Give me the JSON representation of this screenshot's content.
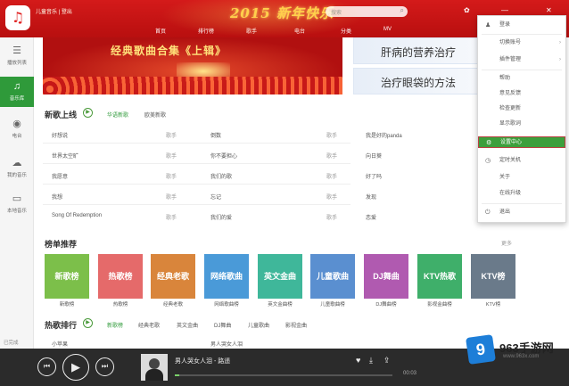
{
  "app": {
    "logo_glyph": "♫",
    "user_text": "儿童音乐 | 登出",
    "festive_banner": "2015 新年快乐"
  },
  "header": {
    "tabs": [
      "首页",
      "排行榜",
      "歌手",
      "电台",
      "分类",
      "MV"
    ],
    "search_placeholder": "搜索",
    "window_controls": {
      "skin": "✿",
      "minimize": "—",
      "close": "✕"
    }
  },
  "sidebar": {
    "items": [
      {
        "icon": "☰",
        "label": "播放列表",
        "active": false
      },
      {
        "icon": "♫",
        "label": "音乐库",
        "active": true
      },
      {
        "icon": "◉",
        "label": "电台",
        "active": false
      },
      {
        "icon": "☁",
        "label": "我的音乐",
        "active": false
      },
      {
        "icon": "▭",
        "label": "本地音乐",
        "active": false
      }
    ],
    "bottom_label": "已完成"
  },
  "banners": {
    "main_title": "经典歌曲合集《上辑》",
    "side": [
      "肝病的营养治疗",
      "治疗眼袋的方法"
    ]
  },
  "new_songs": {
    "title": "新歌上线",
    "tabs": [
      "华语新歌",
      "欧美新歌"
    ],
    "rows": [
      {
        "left_title": "好想说",
        "left_artist": "歌手",
        "right_title": "倒数",
        "right_artist": "歌手"
      },
      {
        "left_title": "世界太空旷",
        "left_artist": "歌手",
        "right_title": "你不要担心",
        "right_artist": "歌手"
      },
      {
        "left_title": "我愿意",
        "left_artist": "歌手",
        "right_title": "我们的歌",
        "right_artist": "歌手"
      },
      {
        "left_title": "我想",
        "left_artist": "歌手",
        "right_title": "忘记",
        "right_artist": "歌手"
      },
      {
        "left_title": "Song Of Redemption",
        "left_artist": "歌手",
        "right_title": "我们的爱",
        "right_artist": "歌手"
      }
    ],
    "rows_right": [
      {
        "title": "我是好的panda",
        "artist": "歌手"
      },
      {
        "title": "向日葵",
        "artist": "歌手"
      },
      {
        "title": "好了吗",
        "artist": "歌手"
      },
      {
        "title": "发现",
        "artist": "歌手"
      },
      {
        "title": "恋爱",
        "artist": "歌手"
      }
    ]
  },
  "rankings": {
    "title": "榜单推荐",
    "more": "更多",
    "tiles": [
      {
        "label": "新歌榜",
        "caption": "新歌榜",
        "color": "#7cbf4a"
      },
      {
        "label": "热歌榜",
        "caption": "热歌榜",
        "color": "#e56a6a"
      },
      {
        "label": "经典老歌",
        "caption": "经典老歌",
        "color": "#d9853b"
      },
      {
        "label": "网络歌曲",
        "caption": "网络歌曲榜",
        "color": "#4a9ad8"
      },
      {
        "label": "英文金曲",
        "caption": "英文金曲榜",
        "color": "#3fb79a"
      },
      {
        "label": "儿童歌曲",
        "caption": "儿童歌曲榜",
        "color": "#5a8fd0"
      },
      {
        "label": "DJ舞曲",
        "caption": "DJ舞曲榜",
        "color": "#b05ab0"
      },
      {
        "label": "KTV热歌",
        "caption": "影视金曲榜",
        "color": "#3faf6a"
      },
      {
        "label": "KTV榜",
        "caption": "KTV榜",
        "color": "#6a7a8a"
      }
    ]
  },
  "hot": {
    "title": "热歌排行",
    "tabs": [
      "新歌榜",
      "经典老歌",
      "英文金曲",
      "DJ舞曲",
      "儿童歌曲",
      "影视金曲"
    ],
    "first_row_left": "小苹果",
    "first_row_right": "男人哭女人泪"
  },
  "player": {
    "now_playing": "男人哭女人泪 - 路遥",
    "progress": 0.02,
    "time": "00:03"
  },
  "menu": {
    "items": [
      {
        "icon": "♟",
        "label": "登录"
      },
      {
        "icon": "",
        "label": "切换账号",
        "arrow": "›"
      },
      {
        "icon": "",
        "label": "插件管理",
        "arrow": "›"
      },
      {
        "icon": "",
        "label": "帮助"
      },
      {
        "icon": "",
        "label": "意见反馈"
      },
      {
        "icon": "",
        "label": "检查更新"
      },
      {
        "icon": "",
        "label": "显示歌词"
      },
      {
        "icon": "⚙",
        "label": "设置中心",
        "selected": true
      },
      {
        "icon": "◷",
        "label": "定时关机"
      },
      {
        "icon": "",
        "label": "关于"
      },
      {
        "icon": "",
        "label": "在线升级"
      },
      {
        "icon": "⏻",
        "label": "退出"
      }
    ]
  },
  "watermark": {
    "logo": "9",
    "name": "963手游网",
    "url": "www.963x.com",
    "accent": "#1d7ed8"
  }
}
